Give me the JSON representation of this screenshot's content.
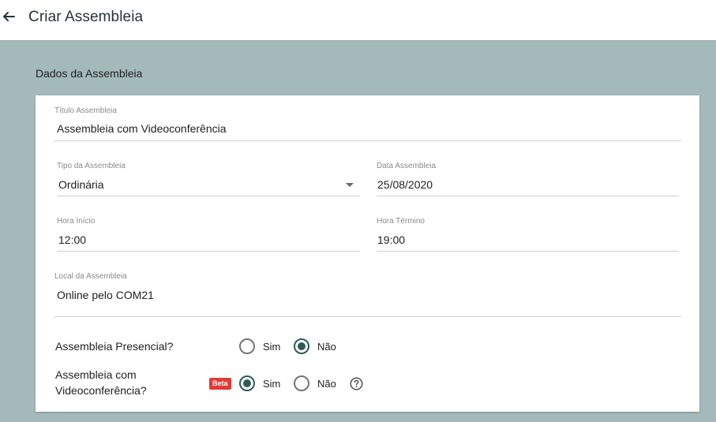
{
  "header": {
    "title": "Criar Assembleia"
  },
  "section": {
    "title": "Dados da Assembleia"
  },
  "form": {
    "titulo": {
      "label": "Título Assembleia",
      "value": "Assembleia com Videoconferência"
    },
    "tipo": {
      "label": "Tipo da Assembleia",
      "value": "Ordinária"
    },
    "data": {
      "label": "Data Assembleia",
      "value": "25/08/2020"
    },
    "hora_inicio": {
      "label": "Hora Início",
      "value": "12:00"
    },
    "hora_termino": {
      "label": "Hora Término",
      "value": "19:00"
    },
    "local": {
      "label": "Local da Assembleia",
      "value": "Online pelo COM21"
    },
    "presencial": {
      "question": "Assembleia Presencial?",
      "options": [
        "Sim",
        "Não"
      ],
      "selected": "Não"
    },
    "videoconferencia": {
      "question_line1": "Assembleia com",
      "question_line2": "Videoconferência?",
      "badge": "Beta",
      "options": [
        "Sim",
        "Não"
      ],
      "selected": "Sim"
    }
  },
  "colors": {
    "accent": "#2d5b58",
    "background": "#a4b9ba",
    "badge": "#e53935"
  },
  "icons": {
    "back": "arrow-left-icon",
    "dropdown": "caret-down-icon",
    "help": "help-circle-icon"
  }
}
